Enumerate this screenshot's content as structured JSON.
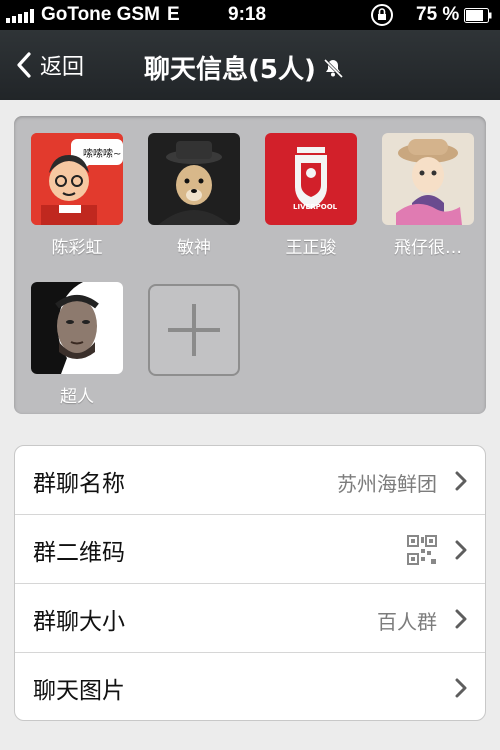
{
  "status_bar": {
    "carrier": "GoTone GSM",
    "network": "E",
    "time": "9:18",
    "battery_percent": "75 %",
    "icons": [
      "signal-icon",
      "rotation-lock-icon",
      "battery-icon"
    ]
  },
  "nav": {
    "back_label": "返回",
    "title": "聊天信息(5人)",
    "icons": [
      "back-chevron-icon",
      "mute-icon"
    ]
  },
  "members": [
    {
      "name": "陈彩虹",
      "avatar": "cartoon-avatar"
    },
    {
      "name": "敏神",
      "avatar": "dog-avatar"
    },
    {
      "name": "王正骏",
      "avatar": "liverpool-crest-avatar"
    },
    {
      "name": "飛仔很…",
      "avatar": "illustrated-girl-avatar"
    },
    {
      "name": "超人",
      "avatar": "portrait-avatar"
    }
  ],
  "cartoon_bubble_text": "嗦嗦嗦~",
  "crest_text": "LIVERPOOL",
  "settings": [
    {
      "label": "群聊名称",
      "value": "苏州海鲜团"
    },
    {
      "label": "群二维码",
      "value": "",
      "icon": "qr-code-icon"
    },
    {
      "label": "群聊大小",
      "value": "百人群"
    },
    {
      "label": "聊天图片",
      "value": ""
    }
  ],
  "colors": {
    "nav_bg": "#262a2d",
    "panel_bg": "#bdbdbf",
    "page_bg": "#ececec"
  }
}
